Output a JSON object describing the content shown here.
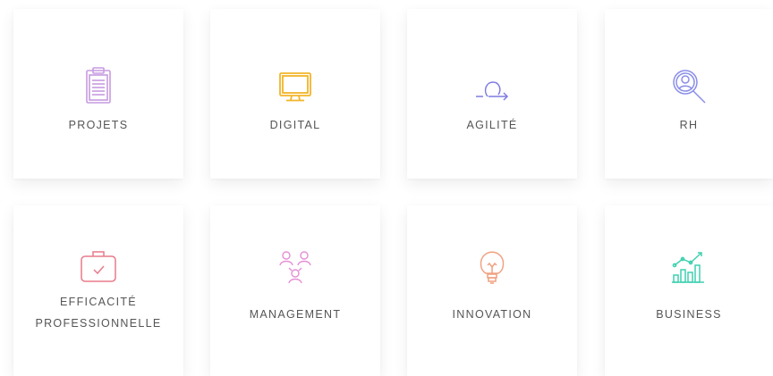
{
  "cards": [
    {
      "label": "PROJETS",
      "icon": "clipboard-icon",
      "color": "#c79be0"
    },
    {
      "label": "DIGITAL",
      "icon": "monitor-icon",
      "color": "#f2b52a"
    },
    {
      "label": "AGILITÉ",
      "icon": "loop-arrow-icon",
      "color": "#7f7ce0"
    },
    {
      "label": "RH",
      "icon": "person-search-icon",
      "color": "#8a8ee8"
    },
    {
      "label_line1": "EFFICACITÉ",
      "label_line2": "PROFESSIONNELLE",
      "icon": "briefcase-check-icon",
      "color": "#e87a8a"
    },
    {
      "label": "MANAGEMENT",
      "icon": "team-icon",
      "color": "#e58fd6"
    },
    {
      "label": "INNOVATION",
      "icon": "lightbulb-icon",
      "color": "#f0a080"
    },
    {
      "label": "BUSINESS",
      "icon": "growth-chart-icon",
      "color": "#3fd0b0"
    }
  ]
}
